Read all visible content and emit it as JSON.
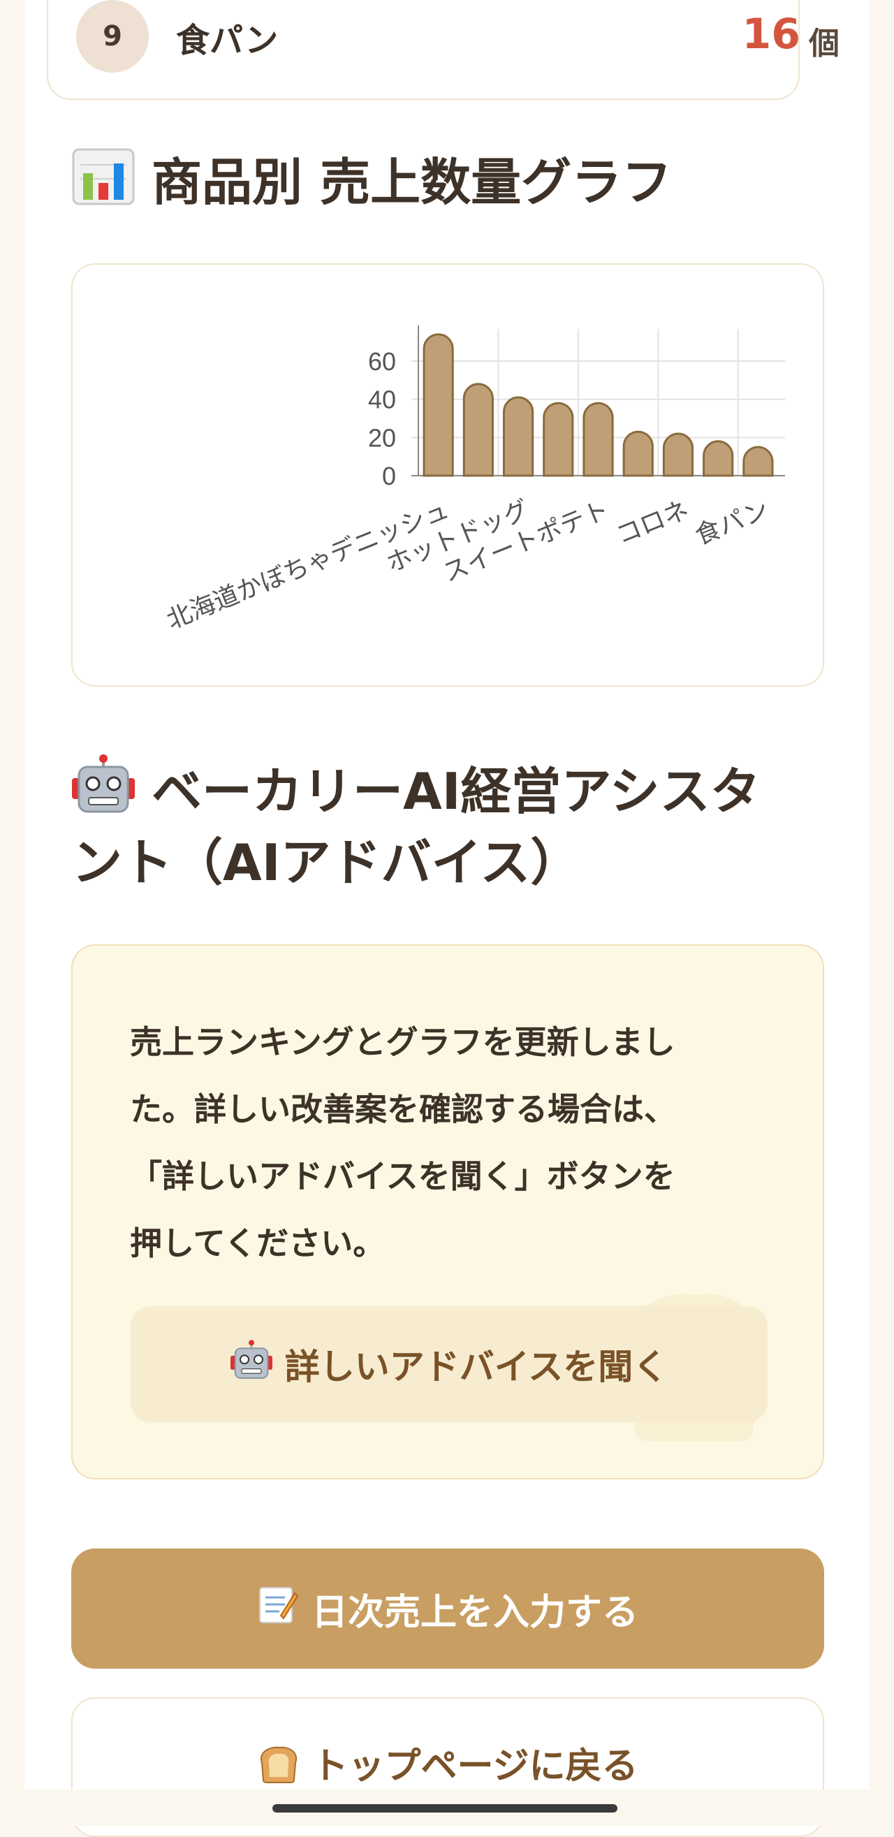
{
  "ranking_last": {
    "rank": "9",
    "name": "食パン",
    "count": "16",
    "unit": "個"
  },
  "chart_section": {
    "title": "商品別 売上数量グラフ",
    "icon": "bar-chart-icon"
  },
  "chart_data": {
    "type": "bar",
    "categories": [
      "北海道かぼちゃデニッシュ",
      "",
      "ホットドッグ",
      "",
      "スイートポテト",
      "",
      "コロネ",
      "",
      "食パン"
    ],
    "values": [
      74,
      48,
      41,
      38,
      38,
      23,
      22,
      18,
      15
    ],
    "x_tick_labels_shown": [
      "北海道かぼちゃデニッシュ",
      "ホットドッグ",
      "スイートポテト",
      "コロネ",
      "食パン"
    ],
    "yticks": [
      "0",
      "20",
      "40",
      "60"
    ],
    "ylim": [
      0,
      75
    ],
    "grid": true,
    "colors": {
      "bar_fill": "#bf9f76",
      "bar_stroke": "#8a6a3e",
      "grid": "#e2e2e2",
      "axis": "#888888",
      "tick_text": "#555555"
    }
  },
  "ai_section": {
    "title_line1": "ベーカリーAI経営アシスタ",
    "title_line2": "ント（AIアドバイス）",
    "icon": "robot-icon",
    "message_lines": [
      "売上ランキングとグラフを更新しまし",
      "た。詳しい改善案を確認する場合は、",
      "「詳しいアドバイスを聞く」ボタンを",
      "押してください。"
    ],
    "advice_button_label": "詳しいアドバイスを聞く"
  },
  "buttons": {
    "input_sales_label": "日次売上を入力する",
    "back_home_label": "トップページに戻る"
  },
  "colors": {
    "primary": "#c89e62",
    "accent_red": "#d4553f",
    "text": "#3e3228"
  }
}
